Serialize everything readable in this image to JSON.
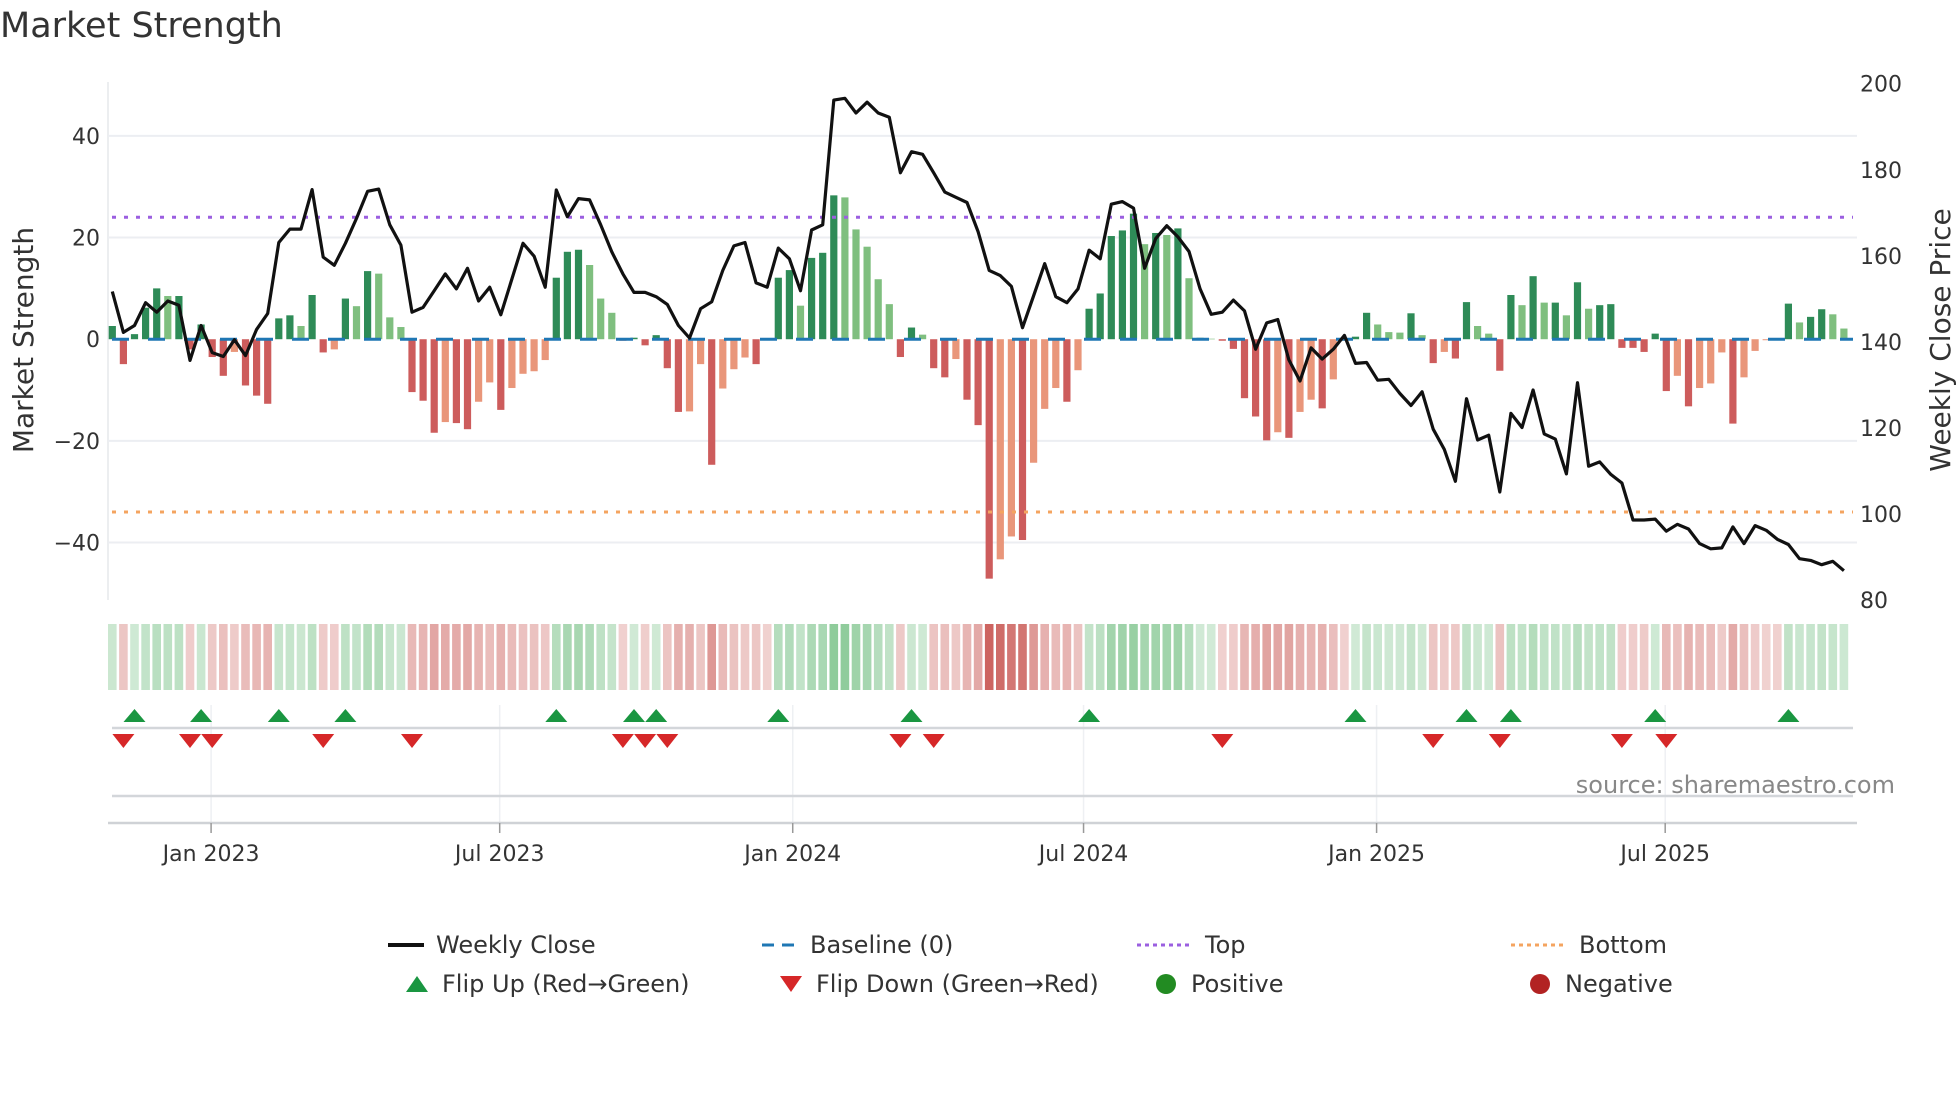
{
  "title": "Market Strength",
  "source": "source: sharemaestro.com",
  "colors": {
    "dark_green": "#2e8b57",
    "light_green": "#7fbf7f",
    "dark_red": "#cd5c5c",
    "salmon": "#e9967a",
    "price_line": "#111111",
    "baseline": "#1f77b4",
    "top": "#9b5fe0",
    "bottom": "#f4a460",
    "flip_up": "#1a9641",
    "flip_down": "#d62728",
    "positive": "#228b22",
    "negative": "#b22222"
  },
  "legend": [
    {
      "label": "Weekly Close",
      "symbol": "solid-line",
      "color": "#111111"
    },
    {
      "label": "Baseline (0)",
      "symbol": "dashed-line",
      "color": "#1f77b4"
    },
    {
      "label": "Top",
      "symbol": "dotted-line",
      "color": "#9b5fe0"
    },
    {
      "label": "Bottom",
      "symbol": "dotted-line",
      "color": "#f4a460"
    },
    {
      "label": "Flip Up (Red→Green)",
      "symbol": "triangle-up",
      "color": "#1a9641"
    },
    {
      "label": "Flip Down (Green→Red)",
      "symbol": "triangle-down",
      "color": "#d62728"
    },
    {
      "label": "Positive",
      "symbol": "circle",
      "color": "#228b22"
    },
    {
      "label": "Negative",
      "symbol": "circle",
      "color": "#b22222"
    }
  ],
  "chart_data": {
    "type": "bar",
    "title": "Market Strength",
    "x_unit": "week index",
    "x_ticks": [
      {
        "label": "Jan 2023",
        "week": 8.9
      },
      {
        "label": "Jul 2023",
        "week": 34.9
      },
      {
        "label": "Jan 2024",
        "week": 61.3
      },
      {
        "label": "Jul 2024",
        "week": 87.5
      },
      {
        "label": "Jan 2025",
        "week": 113.9
      },
      {
        "label": "Jul 2025",
        "week": 139.9
      }
    ],
    "left_axis": {
      "label": "Market Strength",
      "ticks": [
        "−40",
        "−20",
        "0",
        "20",
        "40"
      ],
      "tick_values": [
        -40,
        -20,
        0,
        20,
        40
      ],
      "ylim": [
        -51.3,
        50.6
      ]
    },
    "right_axis": {
      "label": "Weekly Close Price",
      "ticks": [
        "80",
        "100",
        "120",
        "140",
        "160",
        "180",
        "200"
      ],
      "tick_values": [
        80,
        100,
        120,
        140,
        160,
        180,
        200
      ],
      "ylim": [
        80,
        200.4
      ]
    },
    "thresholds": {
      "top": 24,
      "bottom": -34,
      "baseline": 0
    },
    "series": [
      {
        "name": "Market Strength",
        "type": "bar",
        "axis": "left",
        "values": [
          2.6,
          -4.9,
          1.0,
          6.2,
          10.0,
          8.5,
          8.5,
          -2,
          2.9,
          -3.5,
          -7.2,
          -2.5,
          -9.1,
          -11.1,
          -12.7,
          4.1,
          4.7,
          2.6,
          8.7,
          -2.6,
          -2.0,
          8.0,
          6.5,
          13.4,
          12.9,
          4.3,
          2.4,
          -10.4,
          -12.1,
          -18.4,
          -16.3,
          -16.5,
          -17.7,
          -12.3,
          -8.5,
          -13.9,
          -9.6,
          -6.8,
          -6.3,
          -4.1,
          12.1,
          17.2,
          17.6,
          14.6,
          8.0,
          5.2,
          -0.3,
          0.3,
          -1.2,
          0.8,
          -5.7,
          -14.3,
          -14.2,
          -4.9,
          -24.7,
          -9.7,
          -5.9,
          -3.6,
          -4.9,
          -0.2,
          12.1,
          13.6,
          6.6,
          16.0,
          17.0,
          28.3,
          27.9,
          21.6,
          18.2,
          11.8,
          6.9,
          -3.5,
          2.3,
          0.9,
          -5.7,
          -7.5,
          -3.9,
          -11.9,
          -16.9,
          -47.1,
          -43.3,
          -38.8,
          -39.5,
          -24.3,
          -13.7,
          -9.6,
          -12.3,
          -6.1,
          6.0,
          9.0,
          20.3,
          21.4,
          24.7,
          18.7,
          20.9,
          20.5,
          21.8,
          12.0,
          0.3,
          0.1,
          -0.3,
          -1.9,
          -11.6,
          -15.2,
          -19.9,
          -18.3,
          -19.4,
          -14.3,
          -11.9,
          -13.6,
          -7.9,
          -0.3,
          0.5,
          5.2,
          2.9,
          1.4,
          1.3,
          5.1,
          0.8,
          -4.7,
          -2.5,
          -3.8,
          7.3,
          2.6,
          1.1,
          -6.2,
          8.7,
          6.7,
          12.4,
          7.2,
          7.2,
          4.7,
          11.2,
          6.0,
          6.7,
          6.9,
          -1.7,
          -1.7,
          -2.5,
          1.1,
          -10.2,
          -7.2,
          -13.2,
          -9.6,
          -8.7,
          -2.6,
          -16.6,
          -7.5,
          -2.3,
          -0.2,
          -0.1,
          7.0,
          3.3,
          4.4,
          5.9,
          4.9,
          2.1
        ]
      },
      {
        "name": "Weekly Close",
        "type": "line",
        "axis": "right",
        "values": [
          151.7,
          142.2,
          143.8,
          149.1,
          146.9,
          149.5,
          148.5,
          135.7,
          143.8,
          137.5,
          136.6,
          140.5,
          136.8,
          142.9,
          146.6,
          163.1,
          166.2,
          166.2,
          175.4,
          159.7,
          157.8,
          162.9,
          168.7,
          175.0,
          175.5,
          167.2,
          162.5,
          146.9,
          148.0,
          151.9,
          155.8,
          152.3,
          157.1,
          149.5,
          152.7,
          146.3,
          154.6,
          162.9,
          159.9,
          152.7,
          175.3,
          169.1,
          173.3,
          173.0,
          167.2,
          160.9,
          155.8,
          151.5,
          151.5,
          150.5,
          148.7,
          143.8,
          140.9,
          147.7,
          149.3,
          156.6,
          162.3,
          163.1,
          153.7,
          152.7,
          161.8,
          159.3,
          151.9,
          166.0,
          167.2,
          196.2,
          196.6,
          193.2,
          195.7,
          193.2,
          192.2,
          179.3,
          184.2,
          183.6,
          179.3,
          174.8,
          173.6,
          172.4,
          165.6,
          156.6,
          155.4,
          152.9,
          143.3,
          150.7,
          158.2,
          150.5,
          149.1,
          152.3,
          161.3,
          159.3,
          172.0,
          172.6,
          171.1,
          157.1,
          164.0,
          167.0,
          164.4,
          161.0,
          152.3,
          146.4,
          146.9,
          149.7,
          147.2,
          138.3,
          144.4,
          145.2,
          135.8,
          130.9,
          138.6,
          136.0,
          138.3,
          141.5,
          135.0,
          135.2,
          131.1,
          131.3,
          128.0,
          125.2,
          128.4,
          119.7,
          115.0,
          107.6,
          126.8,
          117.2,
          118.3,
          105.1,
          123.4,
          120.1,
          128.8,
          118.6,
          117.4,
          109.3,
          130.5,
          111.1,
          112.1,
          109.2,
          107.2,
          98.6,
          98.6,
          98.8,
          96.0,
          97.6,
          96.5,
          93.1,
          91.9,
          92.1,
          97.0,
          93.1,
          97.3,
          96.2,
          94.1,
          92.9,
          89.6,
          89.2,
          88.2,
          89.0,
          86.8
        ]
      }
    ],
    "flips": {
      "up": [
        2,
        8,
        15,
        21,
        40,
        47,
        49,
        60,
        72,
        88,
        112,
        122,
        126,
        139,
        151
      ],
      "down": [
        1,
        7,
        9,
        19,
        27,
        46,
        48,
        50,
        71,
        74,
        100,
        119,
        125,
        136,
        140
      ]
    },
    "grid": true,
    "legend_position": "bottom-center"
  }
}
